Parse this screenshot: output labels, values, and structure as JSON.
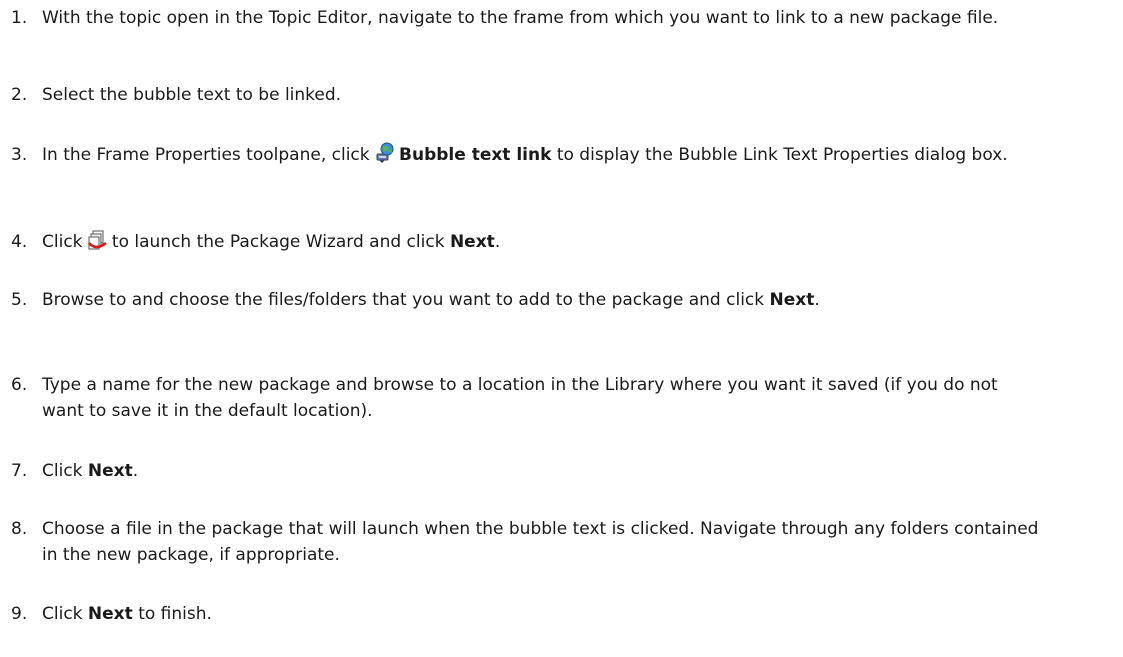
{
  "steps": [
    {
      "number": "1.",
      "text": "With the topic open in the Topic Editor, navigate to the frame from which you want to link to a new package file."
    },
    {
      "number": "2.",
      "text": "Select the bubble text to be linked."
    },
    {
      "number": "3.",
      "before": "In the Frame Properties toolpane, click",
      "icon": "bubble-text-link-icon",
      "bold": "Bubble text link",
      "after": "to display the Bubble Link Text Properties dialog box."
    },
    {
      "number": "4.",
      "before": "Click",
      "icon": "package-wizard-icon",
      "middle": "to launch the Package Wizard and click",
      "bold": "Next",
      "after": "."
    },
    {
      "number": "5.",
      "before": "Browse to and choose the files/folders that you want to add to the package and click",
      "bold": "Next",
      "after": "."
    },
    {
      "number": "6.",
      "text": "Type a name for the new package and browse to a location in the Library where you want it saved (if you do not want to save it in the default location)."
    },
    {
      "number": "7.",
      "before": "Click",
      "bold": "Next",
      "after": "."
    },
    {
      "number": "8.",
      "text": "Choose a file in the package that will launch when the bubble text is clicked. Navigate through any folders contained in the new package, if appropriate."
    },
    {
      "number": "9.",
      "before": "Click",
      "bold": "Next",
      "after": "to finish."
    }
  ]
}
